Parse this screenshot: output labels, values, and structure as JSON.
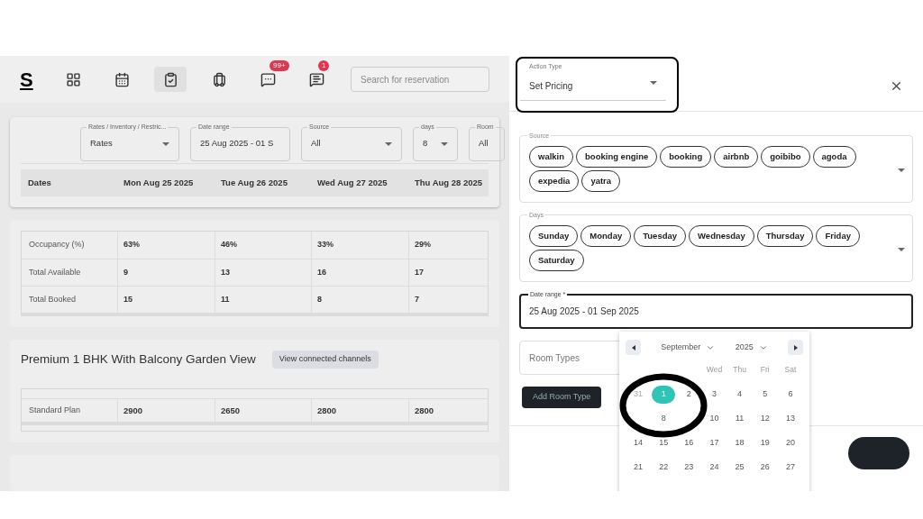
{
  "header": {
    "logo": "S",
    "nav": [
      {
        "kind": "grid",
        "selected": false
      },
      {
        "kind": "calendar",
        "selected": false
      },
      {
        "kind": "clipboard",
        "selected": true
      },
      {
        "kind": "luggage",
        "selected": false
      },
      {
        "kind": "chat",
        "selected": false,
        "badge": "99+"
      },
      {
        "kind": "note",
        "selected": false,
        "badge": "1"
      }
    ],
    "search": {
      "placeholder": "Search for reservation"
    }
  },
  "filters": [
    {
      "label": "Rates / Inventory / Restric...",
      "value": "Rates",
      "kind": "select"
    },
    {
      "label": "Date range",
      "value": "25 Aug 2025 - 01 S",
      "kind": "text"
    },
    {
      "label": "Source",
      "value": "All",
      "kind": "select"
    },
    {
      "label": "days",
      "value": "8",
      "kind": "select"
    },
    {
      "label": "Room",
      "value": "All",
      "kind": "text"
    }
  ],
  "table": {
    "columns": [
      "Dates",
      "Mon Aug 25 2025",
      "Tue Aug 26 2025",
      "Wed Aug 27 2025",
      "Thu Aug 28 2025"
    ]
  },
  "stats": [
    {
      "label": "Occupancy (%)",
      "values": [
        "63%",
        "46%",
        "33%",
        "29%"
      ]
    },
    {
      "label": "Total Available",
      "values": [
        "9",
        "13",
        "16",
        "17"
      ]
    },
    {
      "label": "Total Booked",
      "values": [
        "15",
        "11",
        "8",
        "7"
      ]
    }
  ],
  "room": {
    "title": "Premium 1 BHK With Balcony Garden View",
    "button": "View connected channels",
    "plans": [
      {
        "label": "Standard Plan",
        "values": [
          "2900",
          "2650",
          "2800",
          "2800"
        ]
      }
    ]
  },
  "drawer": {
    "action_type": {
      "label": "Action Type",
      "value": "Set Pricing"
    },
    "source": {
      "label": "Source",
      "chips": [
        "walkin",
        "booking engine",
        "booking",
        "airbnb",
        "goibibo",
        "agoda",
        "expedia",
        "yatra"
      ]
    },
    "days": {
      "label": "Days",
      "chips": [
        "Sunday",
        "Monday",
        "Tuesday",
        "Wednesday",
        "Thursday",
        "Friday",
        "Saturday"
      ]
    },
    "date_range": {
      "label": "Date range *",
      "value": "25 Aug 2025 - 01 Sep 2025"
    },
    "room_types": {
      "placeholder": "Room Types"
    },
    "add_button": "Add Room Type",
    "calendar": {
      "month": "September",
      "year": "2025",
      "weekdays": [
        {
          "kind": "covered"
        },
        {
          "kind": "covered"
        },
        {
          "kind": "covered"
        },
        {
          "kind": "label",
          "label": "Wed"
        },
        {
          "kind": "label",
          "label": "Thu"
        },
        {
          "kind": "label",
          "label": "Fri"
        },
        {
          "kind": "label",
          "label": "Sat"
        }
      ],
      "weeks": [
        [
          {
            "day": "31",
            "muted": true,
            "selected": false
          },
          {
            "day": "1",
            "muted": false,
            "selected": true
          },
          {
            "day": "2",
            "muted": false,
            "selected": false
          },
          {
            "day": "3",
            "muted": false,
            "selected": false
          },
          {
            "day": "4",
            "muted": false,
            "selected": false
          },
          {
            "day": "5",
            "muted": false,
            "selected": false
          },
          {
            "day": "6",
            "muted": false,
            "selected": false
          }
        ],
        [
          {
            "kind": "covered"
          },
          {
            "day": "8",
            "muted": false,
            "selected": false
          },
          {
            "kind": "covered"
          },
          {
            "day": "10",
            "muted": false,
            "selected": false
          },
          {
            "day": "11",
            "muted": false,
            "selected": false
          },
          {
            "day": "12",
            "muted": false,
            "selected": false
          },
          {
            "day": "13",
            "muted": false,
            "selected": false
          }
        ],
        [
          {
            "day": "14",
            "muted": false,
            "selected": false
          },
          {
            "day": "15",
            "muted": false,
            "selected": false
          },
          {
            "day": "16",
            "muted": false,
            "selected": false
          },
          {
            "day": "17",
            "muted": false,
            "selected": false
          },
          {
            "day": "18",
            "muted": false,
            "selected": false
          },
          {
            "day": "19",
            "muted": false,
            "selected": false
          },
          {
            "day": "20",
            "muted": false,
            "selected": false
          }
        ],
        [
          {
            "day": "21",
            "muted": false,
            "selected": false
          },
          {
            "day": "22",
            "muted": false,
            "selected": false
          },
          {
            "day": "23",
            "muted": false,
            "selected": false
          },
          {
            "day": "24",
            "muted": false,
            "selected": false
          },
          {
            "day": "25",
            "muted": false,
            "selected": false
          },
          {
            "day": "26",
            "muted": false,
            "selected": false
          },
          {
            "day": "27",
            "muted": false,
            "selected": false
          }
        ]
      ]
    }
  }
}
